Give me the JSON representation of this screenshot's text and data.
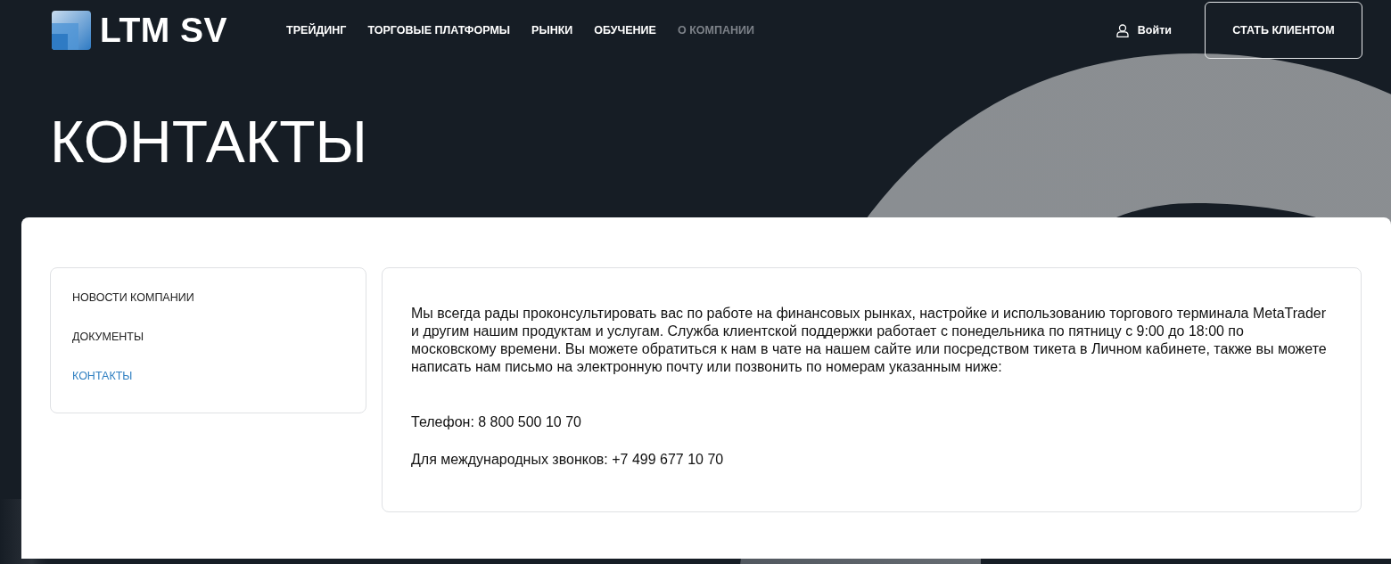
{
  "header": {
    "logo": "LTM SV",
    "nav": [
      {
        "label": "ТРЕЙДИНГ",
        "selected": false
      },
      {
        "label": "ТОРГОВЫЕ ПЛАТФОРМЫ",
        "selected": false
      },
      {
        "label": "РЫНКИ",
        "selected": false
      },
      {
        "label": "ОБУЧЕНИЕ",
        "selected": false
      },
      {
        "label": "О КОМПАНИИ",
        "selected": true
      }
    ],
    "login": "Войти",
    "cta": "СТАТЬ КЛИЕНТОМ"
  },
  "page_title": "КОНТАКТЫ",
  "sidebar": {
    "items": [
      {
        "label": "НОВОСТИ КОМПАНИИ",
        "selected": false
      },
      {
        "label": "ДОКУМЕНТЫ",
        "selected": false
      },
      {
        "label": "КОНТАКТЫ",
        "selected": true
      }
    ]
  },
  "content": {
    "intro": "Мы всегда рады проконсультировать вас по работе на финансовых рынках, настройке и использованию торгового терминала MetaTrader и другим нашим продуктам и услугам. Служба клиентской поддержки работает с понедельника по пятницу с 9:00 до 18:00 по московскому времени. Вы можете обратиться к нам в чате на нашем сайте или посредством тикета в Личном кабинете, также вы можете написать нам письмо на электронную почту или позвонить по номерам указанным ниже:",
    "phones": [
      "Телефон: 8 800 500 10 70",
      "Для международных звонков: +7 499 677 10 70"
    ]
  }
}
